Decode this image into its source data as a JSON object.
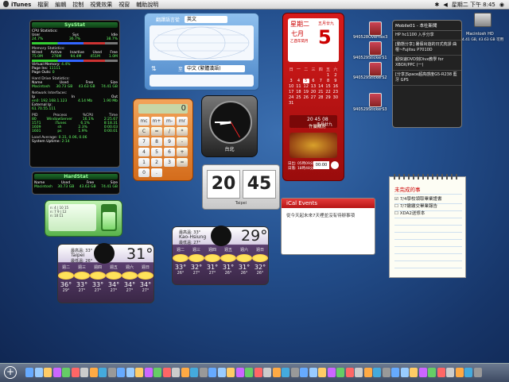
{
  "menubar": {
    "app": "iTunes",
    "items": [
      "檔案",
      "編輯",
      "控制",
      "視覺效果",
      "視窗",
      "輔助說明"
    ],
    "datetime": "星期二 下午 8:45"
  },
  "sysstat": {
    "title": "SysStat",
    "cpu_title": "CPU Statistics:",
    "cpu_cols": [
      "User",
      "Sys",
      "Idle"
    ],
    "cpu_vals": [
      "24.7%",
      "36.7%",
      "38.7%"
    ],
    "mem_title": "Memory Statistics:",
    "mem_cols": [
      "Wired",
      "Active",
      "Inactive",
      "Used",
      "Free"
    ],
    "mem_vals": [
      "75.0M",
      "276M",
      "94.4M",
      "451M",
      "1.0M"
    ],
    "vm_label": "Virtual Memory:",
    "vm_val": "4.4%",
    "pagein_label": "Page Ins:",
    "pagein_val": "11111",
    "pageout_label": "Page Outs:",
    "pageout_val": "0",
    "hd_title": "Hard Drive Statistics:",
    "hd_cols": [
      "Name",
      "Used",
      "Free",
      "Size"
    ],
    "hd_vals": [
      "Macintosh",
      "30.73 GB",
      "43.63 GB",
      "74.41 GB"
    ],
    "net_title": "Network Interfaces:",
    "net_cols": [
      "Ip",
      "In",
      "Out"
    ],
    "net_row1": [
      "en0: 192.168.1.123",
      "4.14 Mb",
      "1.90 Mb"
    ],
    "net_ext_label": "External Ip:",
    "net_ext_val": "61.70.55.111",
    "proc_cols": [
      "PID",
      "Process",
      "%CPU",
      "Time"
    ],
    "procs": [
      [
        "80",
        "WindowServer",
        "16.1%",
        "2:25.67"
      ],
      [
        "1571",
        "iTunes",
        "6.1%",
        "8:18.31"
      ],
      [
        "1609",
        "sh",
        "2.3%",
        "0:00.03"
      ],
      [
        "1601",
        "ps",
        "1.9%",
        "0:00.01"
      ]
    ],
    "load_label": "Load Average:",
    "load_val": "0.31, 0.06, 0.06",
    "uptime_label": "System Uptime:",
    "uptime_val": "2:14"
  },
  "hardstat": {
    "title": "HardStat",
    "cols": [
      "Name",
      "Used",
      "Free",
      "Size"
    ],
    "row": [
      "Macintosh",
      "30.73 GB",
      "43.63 GB",
      "74.41 GB"
    ]
  },
  "translator": {
    "from_label": "翻譯語言從",
    "from_lang": "英文",
    "to_label": "至",
    "to_lang": "中文 (繁體漢語)"
  },
  "calendar": {
    "weekday": "星期二",
    "month_lunar": "七月",
    "lunar_sub": "乙酉年閏月",
    "day_label": "五月廿九",
    "day": "5",
    "headers": [
      "日",
      "一",
      "二",
      "三",
      "四",
      "五",
      "六"
    ],
    "days": [
      "",
      "",
      "",
      "",
      "",
      "1",
      "2",
      "3",
      "4",
      "5",
      "6",
      "7",
      "8",
      "9",
      "10",
      "11",
      "12",
      "13",
      "14",
      "15",
      "16",
      "17",
      "18",
      "19",
      "20",
      "21",
      "22",
      "23",
      "24",
      "25",
      "26",
      "27",
      "28",
      "29",
      "30",
      "31"
    ],
    "today_index": 9,
    "lunar_info": "五月廿九",
    "event1": "忤屬購房",
    "time_text": "20 45 08",
    "bottom1": "日出: 05時09分",
    "bottom2": "日落: 18時48分",
    "clock_display": "00:00"
  },
  "desktop_icons": [
    {
      "label": "940528Overnex3"
    },
    {
      "label": "940529StickerS1"
    },
    {
      "label": "940529StickerS2"
    },
    {
      "label": "940529StickerS3"
    }
  ],
  "hd_icon": {
    "label": "Macintosh HD",
    "sub": "74.41 GB, 43.63 GB 可用"
  },
  "mobile01": {
    "title": "Mobile01 - 本社新聞",
    "items": [
      "HP hc1100 入手分享",
      "[動態分享] 暑假出遊的日式荒謬 曲棍~Fujitsu P7010D",
      "超快速DVD刻Divx教學 for XBOX/PPC (一)",
      "[分享]Space超高感度G5-R238 藍牙 GPS"
    ]
  },
  "calculator": {
    "display": "0",
    "keys": [
      "mc",
      "m+",
      "m-",
      "mr",
      "C",
      "=",
      "/",
      "*",
      "7",
      "8",
      "9",
      "-",
      "4",
      "5",
      "6",
      "+",
      "1",
      "2",
      "3",
      "=",
      "0",
      ".",
      "",
      ""
    ]
  },
  "clock": {
    "city": "台北",
    "hour": 20,
    "minute": 45
  },
  "flipclock": {
    "hour": "20",
    "minute": "45",
    "city": "Taipei"
  },
  "ical": {
    "title": "iCal Events",
    "text": "從今天起未來7天裡並沒有待辦事項"
  },
  "notes": {
    "title": "未完成的事",
    "items": [
      "7/4學校領取畢業證書",
      "7/7繳繳交畢業報告",
      "XDA2送修本"
    ],
    "checked": [
      true,
      false,
      false
    ]
  },
  "green_widget": {
    "line1": "n: 4 | 10 15",
    "line2": "n: 7 9 | 12",
    "line3": "n: 10 11"
  },
  "weather_taipei": {
    "city": "Taipei",
    "hi": "最高溫: 33°",
    "lo": "最低溫: 26°",
    "temp": "31°",
    "days": [
      "週二",
      "週三",
      "週四",
      "週五",
      "週六",
      "週日"
    ],
    "temps": [
      "36°",
      "33°",
      "33°",
      "34°",
      "34°",
      "34°"
    ],
    "lows": [
      "29°",
      "27°",
      "27°",
      "27°",
      "27°",
      "27°"
    ]
  },
  "weather_kaohsiung": {
    "city": "Kao-Hsiung",
    "hi": "最高溫: 33°",
    "lo": "最低溫: 27°",
    "temp": "29°",
    "days": [
      "週二",
      "週三",
      "週四",
      "週五",
      "週六",
      "週日"
    ],
    "temps": [
      "33°",
      "32°",
      "31°",
      "31°",
      "31°",
      "32°"
    ],
    "lows": [
      "26°",
      "27°",
      "27°",
      "26°",
      "26°",
      "26°"
    ]
  },
  "dock": {
    "plus": "+"
  }
}
